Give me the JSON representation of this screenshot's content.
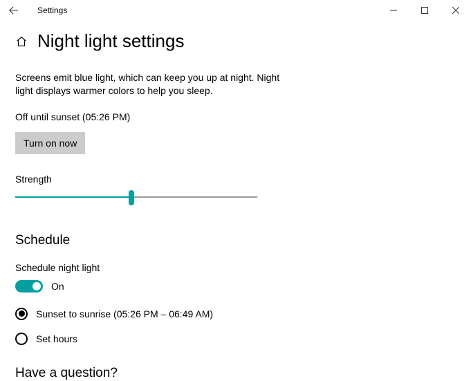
{
  "window": {
    "title": "Settings"
  },
  "page": {
    "title": "Night light settings",
    "description": "Screens emit blue light, which can keep you up at night. Night light displays warmer colors to help you sleep.",
    "status": "Off until sunset (05:26 PM)",
    "turn_on_label": "Turn on now",
    "strength_label": "Strength",
    "strength_value_pct": 48
  },
  "schedule": {
    "heading": "Schedule",
    "toggle_label": "Schedule night light",
    "toggle_state": "On",
    "toggle_on": true,
    "options": {
      "sunset": {
        "label": "Sunset to sunrise (05:26 PM – 06:49 AM)",
        "selected": true
      },
      "set_hours": {
        "label": "Set hours",
        "selected": false
      }
    }
  },
  "help": {
    "heading": "Have a question?"
  },
  "colors": {
    "accent": "#00a0a0"
  }
}
